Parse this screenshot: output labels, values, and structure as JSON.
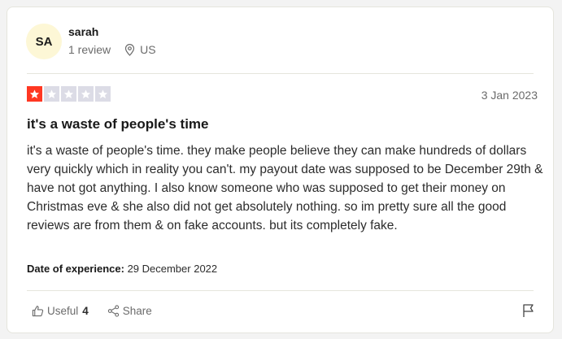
{
  "reviewer": {
    "initials": "SA",
    "name": "sarah",
    "review_count": "1 review",
    "country": "US"
  },
  "review": {
    "rating": 1,
    "rating_max": 5,
    "date": "3 Jan 2023",
    "title": "it's a waste of people's time",
    "body": "it's a waste of people's time. they make people believe they can make hundreds of dollars very quickly which in reality you can't. my payout date was supposed to be December 29th & have not got anything. I also know someone who was supposed to get their money on Christmas eve & she also did not get absolutely nothing. so im pretty sure all the good reviews are from them & on fake accounts. but its completely fake.",
    "experience_label": "Date of experience:",
    "experience_date": "29 December 2022"
  },
  "actions": {
    "useful_label": "Useful",
    "useful_count": "4",
    "share_label": "Share"
  },
  "colors": {
    "star_filled": "#ff3722",
    "star_empty": "#dcdce6",
    "avatar_bg": "#fdf7d6"
  },
  "icons": {
    "location": "location-pin-icon",
    "useful": "thumbs-up-icon",
    "share": "share-icon",
    "flag": "flag-icon",
    "star": "star-icon"
  }
}
